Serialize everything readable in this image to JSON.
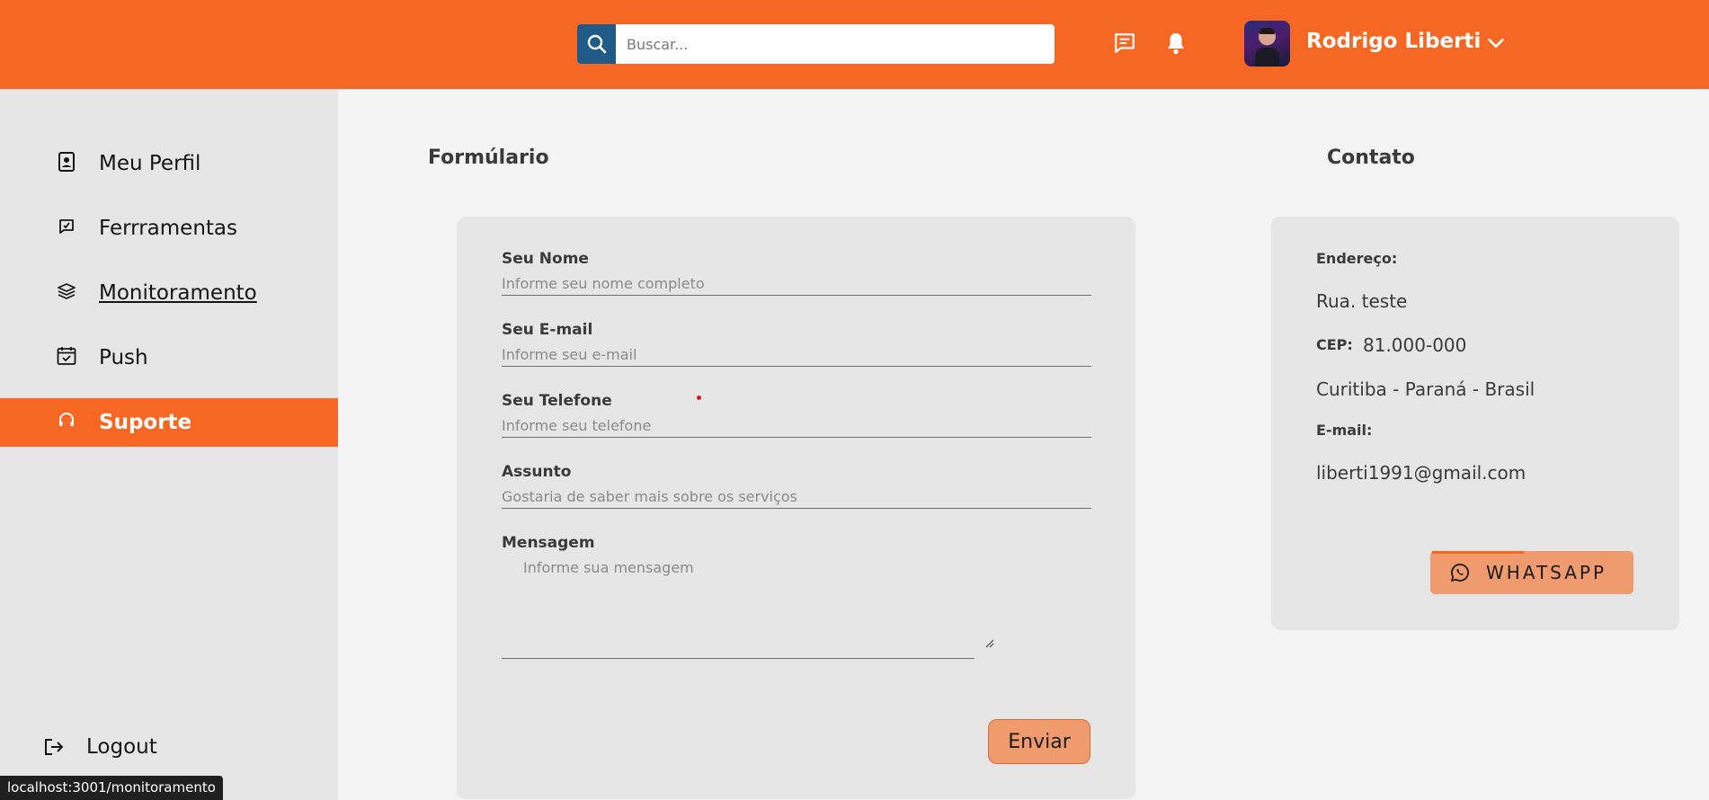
{
  "header": {
    "search": {
      "placeholder": "Buscar..."
    },
    "user": {
      "name": "Rodrigo Liberti"
    }
  },
  "sidebar": {
    "items": [
      {
        "label": "Meu Perfil",
        "icon": "profile-icon"
      },
      {
        "label": "Ferrramentas",
        "icon": "tools-icon"
      },
      {
        "label": "Monitoramento",
        "icon": "monitor-icon"
      },
      {
        "label": "Push",
        "icon": "calendar-check-icon"
      },
      {
        "label": "Suporte",
        "icon": "headset-icon"
      }
    ],
    "logout": "Logout"
  },
  "status_url": "localhost:3001/monitoramento",
  "form": {
    "title": "Formúlario",
    "fields": [
      {
        "label": "Seu Nome",
        "placeholder": "Informe seu nome completo"
      },
      {
        "label": "Seu E-mail",
        "placeholder": "Informe seu e-mail"
      },
      {
        "label": "Seu Telefone",
        "placeholder": "Informe seu telefone"
      },
      {
        "label": "Assunto",
        "placeholder": "Gostaria de saber mais sobre os serviços"
      }
    ],
    "message": {
      "label": "Mensagem",
      "placeholder": "Informe sua mensagem"
    },
    "submit": "Enviar"
  },
  "contact": {
    "title": "Contato",
    "address_label": "Endereço:",
    "address": "Rua. teste",
    "cep_label": "CEP:",
    "cep": "81.000-000",
    "city": "Curitiba - Paraná - Brasil",
    "email_label": "E-mail:",
    "email": "liberti1991@gmail.com",
    "whatsapp": "WHATSAPP"
  },
  "colors": {
    "primary": "#f56722",
    "search_button": "#1f5b86",
    "button_fill": "#ef9b6e"
  }
}
